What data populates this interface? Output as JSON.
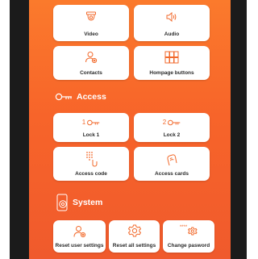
{
  "media": {
    "video_label": "Video",
    "audio_label": "Audio"
  },
  "general": {
    "contacts_label": "Contacts",
    "hompage_buttons_label": "Hompage buttons"
  },
  "access": {
    "title": "Access",
    "lock1_number": "1",
    "lock1_label": "Lock 1",
    "lock2_number": "2",
    "lock2_label": "Lock 2",
    "access_code_label": "Access code",
    "access_cards_label": "Access cards"
  },
  "system": {
    "title": "System",
    "reset_user_label": "Reset user settings",
    "reset_all_label": "Reset all settings",
    "change_password_label": "Change pasword",
    "password_stars": "****"
  },
  "colors": {
    "accent": "#f26a2c",
    "background_top": "#fb7a2c",
    "background_bottom": "#f05a2c",
    "tile": "#ffffff"
  }
}
